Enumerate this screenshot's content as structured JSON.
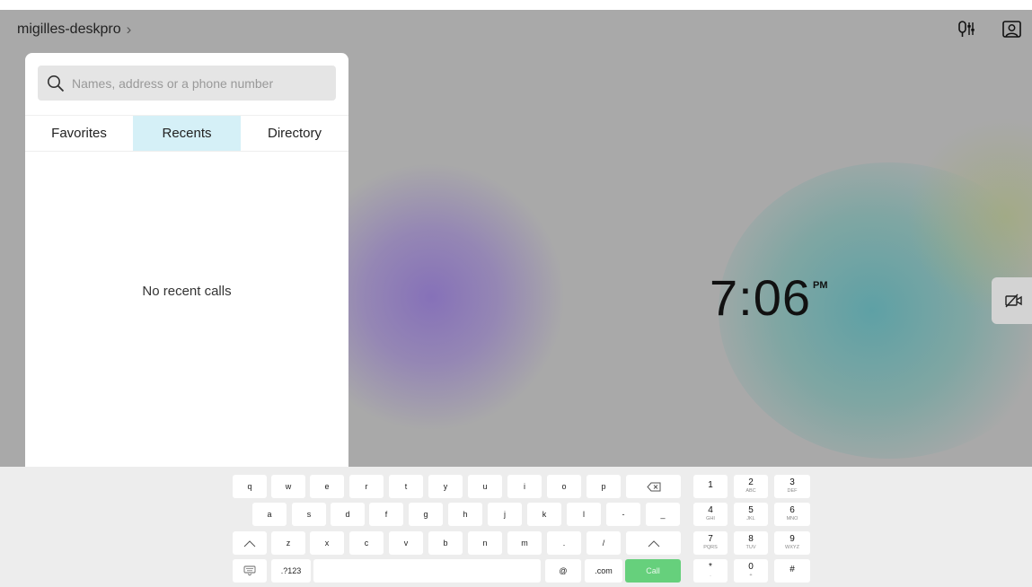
{
  "header": {
    "device_name": "migilles-deskpro",
    "chevron": "›",
    "icons": [
      "mic-settings-icon",
      "selfview-icon"
    ]
  },
  "search": {
    "placeholder": "Names, address or a phone number",
    "value": ""
  },
  "tabs": [
    {
      "label": "Favorites",
      "active": false
    },
    {
      "label": "Recents",
      "active": true
    },
    {
      "label": "Directory",
      "active": false
    }
  ],
  "recents": {
    "empty_message": "No recent calls"
  },
  "clock": {
    "time": "7:06",
    "ampm": "PM"
  },
  "camera_button": {
    "icon": "camera-off-icon"
  },
  "keyboard": {
    "row1": [
      "q",
      "w",
      "e",
      "r",
      "t",
      "y",
      "u",
      "i",
      "o",
      "p"
    ],
    "row2": [
      "a",
      "s",
      "d",
      "f",
      "g",
      "h",
      "j",
      "k",
      "l",
      "-",
      "_"
    ],
    "row3": [
      "z",
      "x",
      "c",
      "v",
      "b",
      "n",
      "m",
      ".",
      "/"
    ],
    "switch_label": ".?123",
    "at_label": "@",
    "com_label": ".com",
    "call_label": "Call",
    "numpad": [
      {
        "digit": "1",
        "letters": ""
      },
      {
        "digit": "2",
        "letters": "ABC"
      },
      {
        "digit": "3",
        "letters": "DEF"
      },
      {
        "digit": "4",
        "letters": "GHI"
      },
      {
        "digit": "5",
        "letters": "JKL"
      },
      {
        "digit": "6",
        "letters": "MNO"
      },
      {
        "digit": "7",
        "letters": "PQRS"
      },
      {
        "digit": "8",
        "letters": "TUV"
      },
      {
        "digit": "9",
        "letters": "WXYZ"
      },
      {
        "digit": "*",
        "letters": "."
      },
      {
        "digit": "0",
        "letters": "+"
      },
      {
        "digit": "#",
        "letters": ""
      }
    ]
  },
  "colors": {
    "background": "#a9a9a9",
    "active_tab": "#d5f0f7",
    "call_button": "#66d07c",
    "keyboard_bg": "#ededed"
  }
}
